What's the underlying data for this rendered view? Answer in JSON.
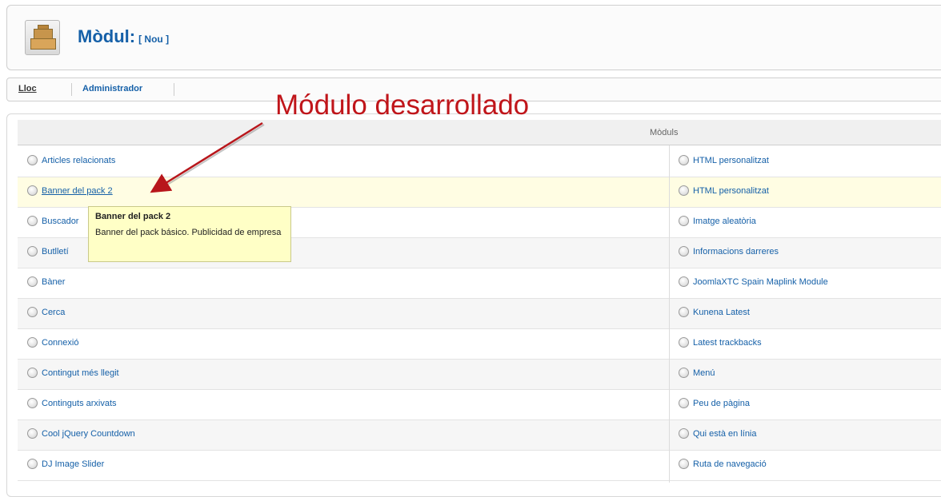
{
  "header": {
    "title": "Mòdul:",
    "subtitle": "[ Nou ]"
  },
  "tabs": [
    {
      "label": "Lloc"
    },
    {
      "label": "Administrador"
    }
  ],
  "table": {
    "header": "Mòduls",
    "rows": [
      {
        "left": "Articles relacionats",
        "right": "HTML personalitzat"
      },
      {
        "left": "Banner del pack 2",
        "right": "HTML personalitzat"
      },
      {
        "left": "Buscador",
        "right": "Imatge aleatòria"
      },
      {
        "left": "Butlletí",
        "right": "Informacions darreres"
      },
      {
        "left": "Bàner",
        "right": "JoomlaXTC Spain Maplink Module"
      },
      {
        "left": "Cerca",
        "right": "Kunena Latest"
      },
      {
        "left": "Connexió",
        "right": "Latest trackbacks"
      },
      {
        "left": "Contingut més llegit",
        "right": "Menú"
      },
      {
        "left": "Continguts arxivats",
        "right": "Peu de pàgina"
      },
      {
        "left": "Cool jQuery Countdown",
        "right": "Qui està en línia"
      },
      {
        "left": "DJ Image Slider",
        "right": "Ruta de navegació"
      }
    ]
  },
  "tooltip": {
    "title": "Banner del pack 2",
    "body": "Banner del pack básico. Publicidad de empresa"
  },
  "annotation": {
    "text": "Módulo desarrollado",
    "color": "#c0151a"
  }
}
